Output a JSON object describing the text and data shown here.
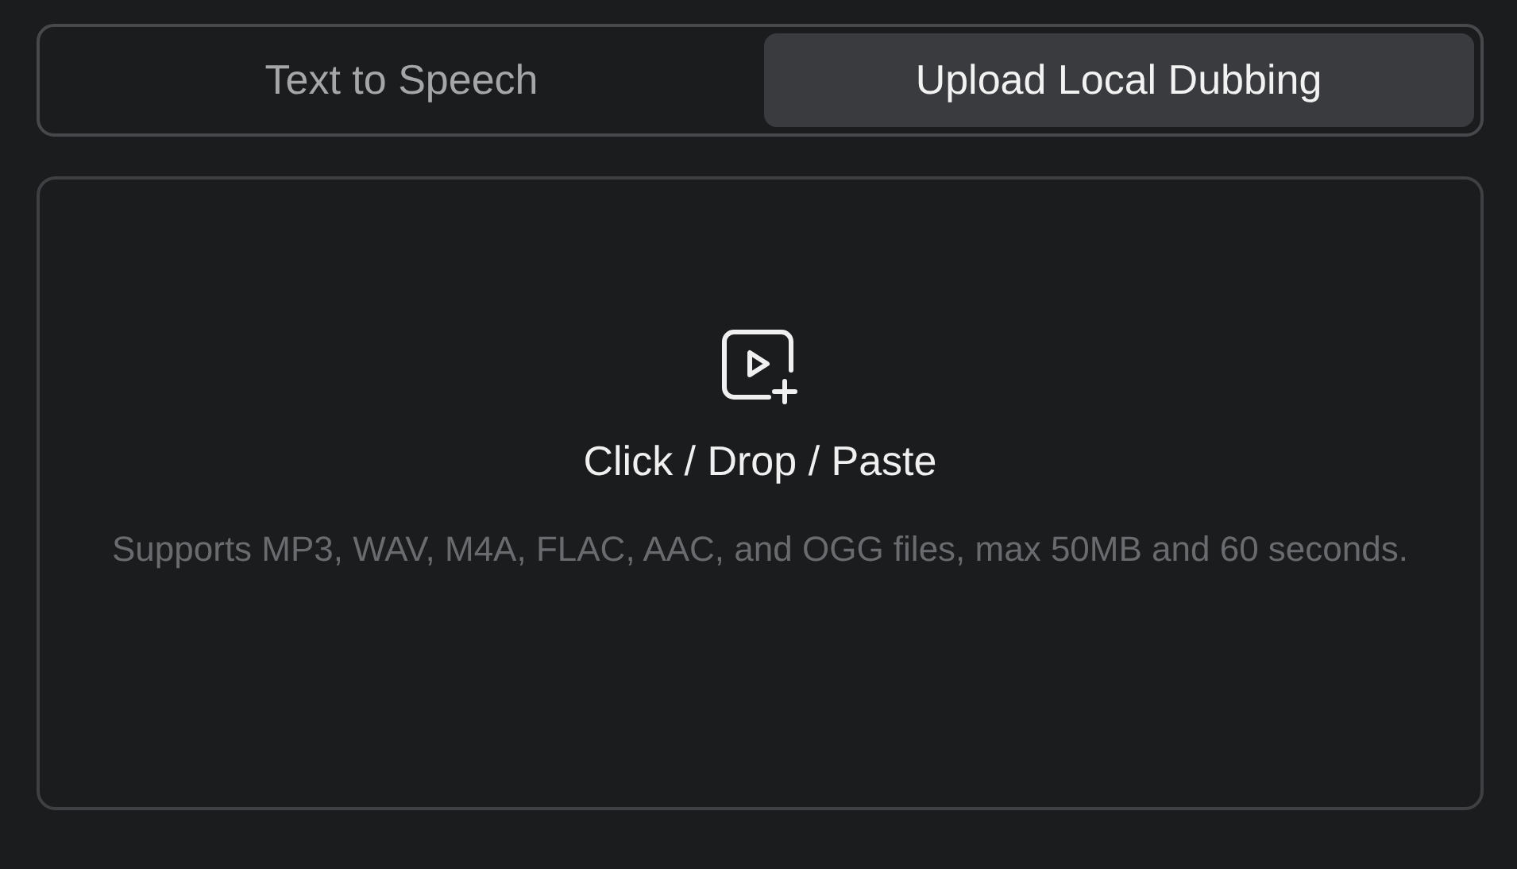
{
  "tabs": [
    {
      "label": "Text to Speech",
      "selected": false
    },
    {
      "label": "Upload Local Dubbing",
      "selected": true
    }
  ],
  "upload": {
    "title": "Click / Drop / Paste",
    "hint": "Supports MP3, WAV, M4A, FLAC, AAC, and OGG files, max 50MB and 60 seconds."
  }
}
